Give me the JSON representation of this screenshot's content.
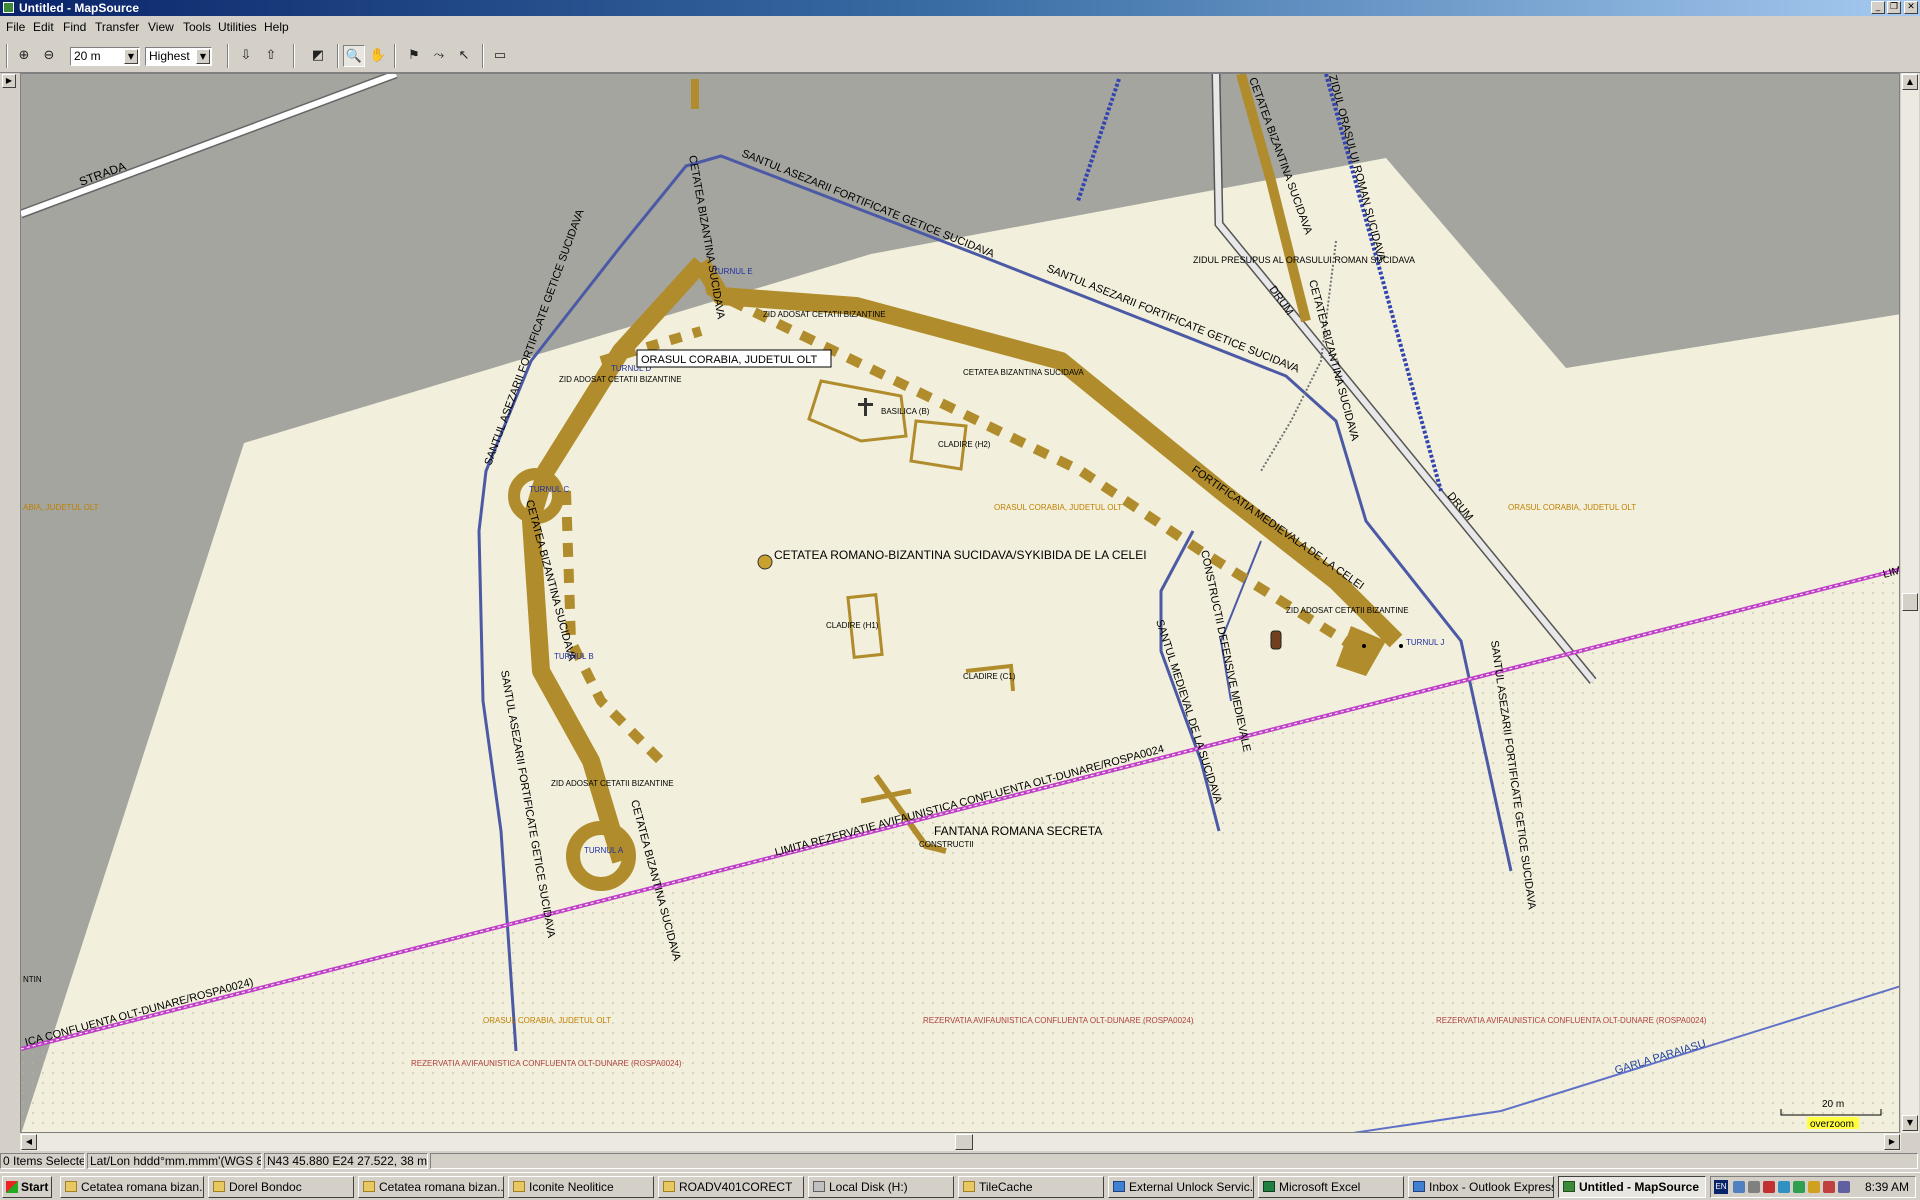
{
  "window": {
    "title": "Untitled - MapSource"
  },
  "menu": [
    "File",
    "Edit",
    "Find",
    "Transfer",
    "View",
    "Tools",
    "Utilities",
    "Help"
  ],
  "toolbar": {
    "zoom_value": "20 m",
    "detail_value": "Highest"
  },
  "map": {
    "tooltip": "ORASUL CORABIA, JUDETUL OLT",
    "poi_main": "CETATEA ROMANO-BIZANTINA SUCIDAVA/SYKIBIDA DE LA CELEI",
    "poi_fountain": "FANTANA ROMANA SECRETA",
    "labels": {
      "strada": "STRADA",
      "santul_top": "SANTUL ASEZARII FORTIFICATE GETICE SUCIDAVA",
      "santul_top_right": "SANTUL ASEZARII FORTIFICATE GETICE SUCIDAVA",
      "santul_left": "SANTUL ASEZARII FORTIFICATE GETICE SUCIDAVA",
      "santul_left_low": "SANTUL ASEZARII FORTIFICATE GETICE SUCIDAVA",
      "santul_right_low": "SANTUL ASEZARII FORTIFICATE GETICE SUCIDAVA",
      "cetatea_biz_top": "CETATEA BIZANTINA SUCIDAVA",
      "cetatea_biz_left": "CETATEA BIZANTINA SUCIDAVA",
      "cetatea_biz_low": "CETATEA BIZANTINA SUCIDAVA",
      "cetatea_biz_right": "CETATEA BIZANTINA SUCIDAVA",
      "cetatea_biz_roman": "CETATEA BIZANTINA SUCIDAVA",
      "cetatea_biz_right_top": "CETATEA BIZANTINA SUCIDAVA",
      "zid_presupus": "ZIDUL PRESUPUS AL ORASULUI ROMAN SUCIDAVA",
      "zid_roman_suc": "ZIDUL ORASULUI ROMAN SUCIDAVA",
      "drum_upper": "DRUM",
      "drum_lower": "DRUM",
      "fortif_med": "FORTIFICATIA MEDIEVALA DE LA CELEI",
      "constructii_def": "CONSTRUCTII DEFENSIVE MEDIEVALE",
      "santul_medieval": "SANTUL MEDIEVAL DE LA SUCIDAVA",
      "limita_rez": "LIMITA REZERVATIE AVIFAUNISTICA CONFLUENTA OLT-DUNARE/ROSPA0024",
      "confluenta_left": "ICA CONFLUENTA OLT-DUNARE/ROSPA0024)",
      "limita_right": "LIMI",
      "garla": "GARLA PARAIASU",
      "turnul_e": "TURNUL E",
      "turnul_d": "TURNUL D",
      "turnul_c": "TURNUL C",
      "turnul_b": "TURNUL B",
      "turnul_a": "TURNUL A",
      "turnul_j": "TURNUL J",
      "zid_ados_1": "ZID ADOSAT CETATII BIZANTINE",
      "zid_ados_2": "ZID ADOSAT CETATII BIZANTINE",
      "zid_ados_3": "ZID ADOSAT CETATII BIZANTINE",
      "zid_ados_4": "ZID ADOSAT CETATII BIZANTINE",
      "cetatea_biz_small": "CETATEA BIZANTINA SUCIDAVA",
      "basilica": "BASILICA (B)",
      "cladire_h2": "CLADIRE (H2)",
      "cladire_h1": "CLADIRE (H1)",
      "cladire_c1": "CLADIRE (C1)",
      "constructii": "CONSTRUCTII",
      "orasul_center": "ORASUL CORABIA, JUDETUL OLT",
      "orasul_right": "ORASUL CORABIA, JUDETUL OLT",
      "orasul_bottom": "ORASUL CORABIA, JUDETUL OLT",
      "orasul_leftedge": "ABIA, JUDETUL OLT",
      "rez_bottom_mid": "REZERVATIA AVIFAUNISTICA CONFLUENTA OLT-DUNARE (ROSPA0024)",
      "rez_bottom_right": "REZERVATIA AVIFAUNISTICA CONFLUENTA OLT-DUNARE (ROSPA0024)",
      "rez_bottom_left": "REZERVATIA AVIFAUNISTICA CONFLUENTA OLT-DUNARE (ROSPA0024)",
      "ntin": "NTIN"
    },
    "scale_text": "20 m",
    "overzoom_text": "overzoom",
    "colors": {
      "wall": "#b08c2c",
      "land": "#f2f0dc",
      "urban": "#a4a59f",
      "ditch": "#4c5aa6",
      "reserve": "#c040c8",
      "road": "#909090"
    }
  },
  "status": {
    "selected": "0 Items Selected",
    "format": "Lat/Lon hddd°mm.mmm'(WGS 84)",
    "position": "N43 45.880 E24 27.522, 38 m"
  },
  "taskbar": {
    "start": "Start",
    "tasks": [
      "Cetatea romana bizan...",
      "Dorel Bondoc",
      "Cetatea romana bizan...",
      "Iconite Neolitice",
      "ROADV401CORECT",
      "Local Disk (H:)",
      "TileCache",
      "External Unlock Servic...",
      "Microsoft Excel",
      "Inbox - Outlook Express",
      "Untitled - MapSource"
    ],
    "lang": "EN",
    "clock": "8:39 AM"
  }
}
